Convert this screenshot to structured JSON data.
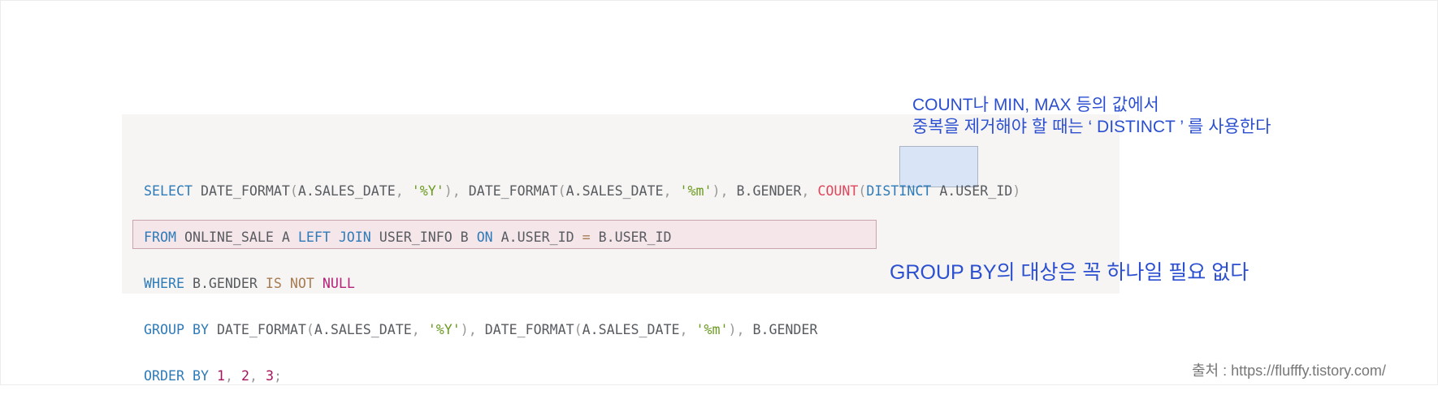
{
  "code": {
    "line1": {
      "select": "SELECT",
      "fn1": "DATE_FORMAT",
      "open1": "(",
      "arg1": "A.SALES_DATE",
      "comma1": ",",
      "str1": "'%Y'",
      "close1": ")",
      "comma2": ",",
      "fn2": "DATE_FORMAT",
      "open2": "(",
      "arg2": "A.SALES_DATE",
      "comma3": ",",
      "str2": "'%m'",
      "close2": ")",
      "comma4": ",",
      "col": "B.GENDER",
      "comma5": ",",
      "count": "COUNT",
      "open3": "(",
      "distinct": "DISTINCT",
      "arg3": "A.USER_ID",
      "close3": ")"
    },
    "line2": {
      "from": "FROM",
      "table1": "ONLINE_SALE A",
      "left": "LEFT",
      "join": "JOIN",
      "table2": "USER_INFO B",
      "on": "ON",
      "lhs": "A.USER_ID",
      "eq": "=",
      "rhs": "B.USER_ID"
    },
    "line3": {
      "where": "WHERE",
      "col": "B.GENDER",
      "is": "IS",
      "not": "NOT",
      "null": "NULL"
    },
    "line4": {
      "group": "GROUP",
      "by": "BY",
      "fn1": "DATE_FORMAT",
      "open1": "(",
      "arg1": "A.SALES_DATE",
      "comma1": ",",
      "str1": "'%Y'",
      "close1": ")",
      "comma2": ",",
      "fn2": "DATE_FORMAT",
      "open2": "(",
      "arg2": "A.SALES_DATE",
      "comma3": ",",
      "str2": "'%m'",
      "close2": ")",
      "comma4": ",",
      "col": "B.GENDER"
    },
    "line5": {
      "order": "ORDER",
      "by": "BY",
      "n1": "1",
      "comma1": ",",
      "n2": "2",
      "comma2": ",",
      "n3": "3",
      "semi": ";"
    }
  },
  "annotations": {
    "distinct_note_line1": "COUNT나 MIN, MAX 등의 값에서",
    "distinct_note_line2": "중복을 제거해야 할 때는 ‘ DISTINCT ’ 를 사용한다",
    "groupby_note": "GROUP BY의 대상은 꼭 하나일 필요 없다"
  },
  "source": "출처 : https://flufffy.tistory.com/",
  "colors": {
    "keyword": "#2f7bb8",
    "string": "#6a9a1f",
    "number": "#a4145d",
    "count": "#e0475d",
    "annotation": "#2b4fd0",
    "distinct_highlight": "#d9e4f6",
    "groupby_highlight": "#f5e6ea"
  }
}
